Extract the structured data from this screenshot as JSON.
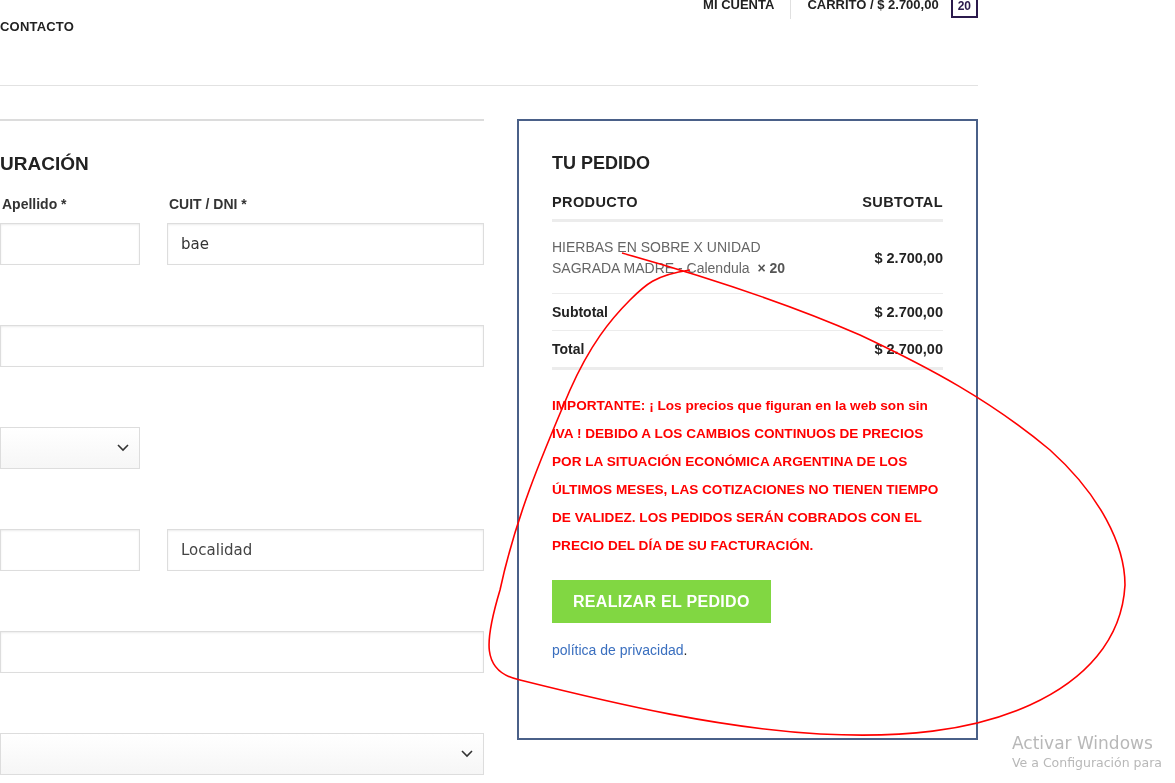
{
  "header": {
    "nav_left": [
      "CONTACTO"
    ],
    "account_link": "MI CUENTA",
    "cart_link": "CARRITO / $ 2.700,00",
    "cart_count": "20"
  },
  "billing": {
    "title": "URACIÓN",
    "rows": [
      {
        "kind": "pair",
        "fields": [
          {
            "kind": "input",
            "label": "Apellido *"
          },
          {
            "kind": "input",
            "label": "CUIT / DNI *",
            "value": "bae"
          }
        ]
      },
      {
        "kind": "wide",
        "fields": [
          {
            "kind": "input"
          }
        ]
      },
      {
        "kind": "pair",
        "fields": [
          {
            "kind": "select"
          }
        ]
      },
      {
        "kind": "pair",
        "fields": [
          {
            "kind": "input"
          },
          {
            "kind": "input",
            "placeholder": "Localidad"
          }
        ]
      },
      {
        "kind": "wide",
        "fields": [
          {
            "kind": "input"
          }
        ]
      },
      {
        "kind": "wide",
        "fields": [
          {
            "kind": "select"
          }
        ]
      }
    ]
  },
  "order": {
    "title": "TU PEDIDO",
    "columns": [
      "PRODUCTO",
      "SUBTOTAL"
    ],
    "items": [
      {
        "name": "HIERBAS EN SOBRE X UNIDAD SAGRADA MADRE - Calendula",
        "quantity": "× 20",
        "subtotal": "$ 2.700,00"
      }
    ],
    "totals": [
      {
        "label": "Subtotal",
        "value": "$ 2.700,00"
      },
      {
        "label": "Total",
        "value": "$ 2.700,00"
      }
    ],
    "notice": "IMPORTANTE: ¡ Los precios que figuran en la web son sin IVA ! DEBIDO A LOS CAMBIOS CONTINUOS DE PRECIOS POR LA SITUACIÓN ECONÓMICA ARGENTINA DE LOS ÚLTIMOS MESES, LAS COTIZACIONES NO TIENEN TIEMPO DE VALIDEZ. LOS PEDIDOS SERÁN COBRADOS CON EL PRECIO DEL DÍA DE SU FACTURACIÓN.",
    "button": "REALIZAR EL PEDIDO",
    "privacy_link": "política de privacidad",
    "privacy_after": "."
  },
  "os_notice": {
    "title": "Activar Windows",
    "subtitle": "Ve a Configuración para"
  }
}
